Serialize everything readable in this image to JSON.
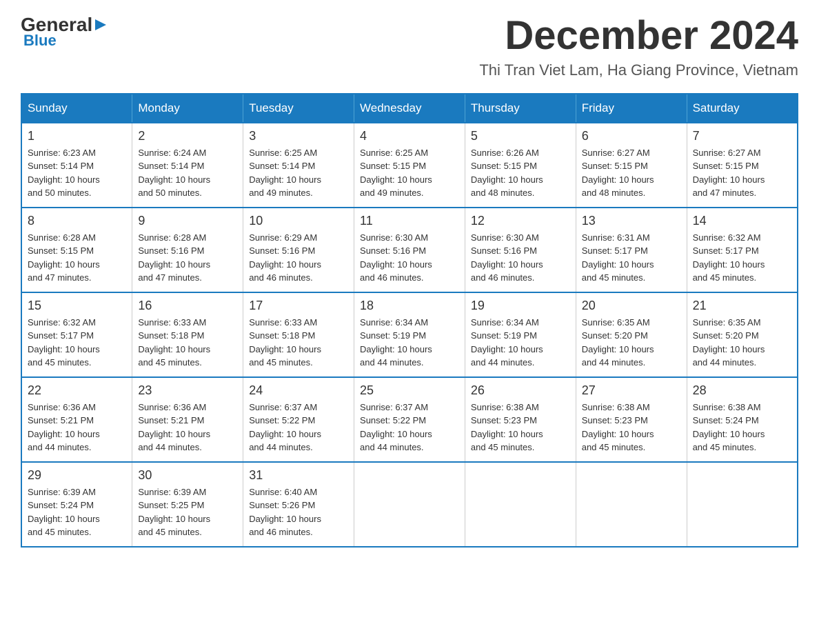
{
  "logo": {
    "general": "General",
    "blue": "Blue",
    "arrow": "▶"
  },
  "title": "December 2024",
  "location": "Thi Tran Viet Lam, Ha Giang Province, Vietnam",
  "days_of_week": [
    "Sunday",
    "Monday",
    "Tuesday",
    "Wednesday",
    "Thursday",
    "Friday",
    "Saturday"
  ],
  "weeks": [
    [
      {
        "num": "1",
        "sunrise": "6:23 AM",
        "sunset": "5:14 PM",
        "daylight": "10 hours and 50 minutes."
      },
      {
        "num": "2",
        "sunrise": "6:24 AM",
        "sunset": "5:14 PM",
        "daylight": "10 hours and 50 minutes."
      },
      {
        "num": "3",
        "sunrise": "6:25 AM",
        "sunset": "5:14 PM",
        "daylight": "10 hours and 49 minutes."
      },
      {
        "num": "4",
        "sunrise": "6:25 AM",
        "sunset": "5:15 PM",
        "daylight": "10 hours and 49 minutes."
      },
      {
        "num": "5",
        "sunrise": "6:26 AM",
        "sunset": "5:15 PM",
        "daylight": "10 hours and 48 minutes."
      },
      {
        "num": "6",
        "sunrise": "6:27 AM",
        "sunset": "5:15 PM",
        "daylight": "10 hours and 48 minutes."
      },
      {
        "num": "7",
        "sunrise": "6:27 AM",
        "sunset": "5:15 PM",
        "daylight": "10 hours and 47 minutes."
      }
    ],
    [
      {
        "num": "8",
        "sunrise": "6:28 AM",
        "sunset": "5:15 PM",
        "daylight": "10 hours and 47 minutes."
      },
      {
        "num": "9",
        "sunrise": "6:28 AM",
        "sunset": "5:16 PM",
        "daylight": "10 hours and 47 minutes."
      },
      {
        "num": "10",
        "sunrise": "6:29 AM",
        "sunset": "5:16 PM",
        "daylight": "10 hours and 46 minutes."
      },
      {
        "num": "11",
        "sunrise": "6:30 AM",
        "sunset": "5:16 PM",
        "daylight": "10 hours and 46 minutes."
      },
      {
        "num": "12",
        "sunrise": "6:30 AM",
        "sunset": "5:16 PM",
        "daylight": "10 hours and 46 minutes."
      },
      {
        "num": "13",
        "sunrise": "6:31 AM",
        "sunset": "5:17 PM",
        "daylight": "10 hours and 45 minutes."
      },
      {
        "num": "14",
        "sunrise": "6:32 AM",
        "sunset": "5:17 PM",
        "daylight": "10 hours and 45 minutes."
      }
    ],
    [
      {
        "num": "15",
        "sunrise": "6:32 AM",
        "sunset": "5:17 PM",
        "daylight": "10 hours and 45 minutes."
      },
      {
        "num": "16",
        "sunrise": "6:33 AM",
        "sunset": "5:18 PM",
        "daylight": "10 hours and 45 minutes."
      },
      {
        "num": "17",
        "sunrise": "6:33 AM",
        "sunset": "5:18 PM",
        "daylight": "10 hours and 45 minutes."
      },
      {
        "num": "18",
        "sunrise": "6:34 AM",
        "sunset": "5:19 PM",
        "daylight": "10 hours and 44 minutes."
      },
      {
        "num": "19",
        "sunrise": "6:34 AM",
        "sunset": "5:19 PM",
        "daylight": "10 hours and 44 minutes."
      },
      {
        "num": "20",
        "sunrise": "6:35 AM",
        "sunset": "5:20 PM",
        "daylight": "10 hours and 44 minutes."
      },
      {
        "num": "21",
        "sunrise": "6:35 AM",
        "sunset": "5:20 PM",
        "daylight": "10 hours and 44 minutes."
      }
    ],
    [
      {
        "num": "22",
        "sunrise": "6:36 AM",
        "sunset": "5:21 PM",
        "daylight": "10 hours and 44 minutes."
      },
      {
        "num": "23",
        "sunrise": "6:36 AM",
        "sunset": "5:21 PM",
        "daylight": "10 hours and 44 minutes."
      },
      {
        "num": "24",
        "sunrise": "6:37 AM",
        "sunset": "5:22 PM",
        "daylight": "10 hours and 44 minutes."
      },
      {
        "num": "25",
        "sunrise": "6:37 AM",
        "sunset": "5:22 PM",
        "daylight": "10 hours and 44 minutes."
      },
      {
        "num": "26",
        "sunrise": "6:38 AM",
        "sunset": "5:23 PM",
        "daylight": "10 hours and 45 minutes."
      },
      {
        "num": "27",
        "sunrise": "6:38 AM",
        "sunset": "5:23 PM",
        "daylight": "10 hours and 45 minutes."
      },
      {
        "num": "28",
        "sunrise": "6:38 AM",
        "sunset": "5:24 PM",
        "daylight": "10 hours and 45 minutes."
      }
    ],
    [
      {
        "num": "29",
        "sunrise": "6:39 AM",
        "sunset": "5:24 PM",
        "daylight": "10 hours and 45 minutes."
      },
      {
        "num": "30",
        "sunrise": "6:39 AM",
        "sunset": "5:25 PM",
        "daylight": "10 hours and 45 minutes."
      },
      {
        "num": "31",
        "sunrise": "6:40 AM",
        "sunset": "5:26 PM",
        "daylight": "10 hours and 46 minutes."
      },
      null,
      null,
      null,
      null
    ]
  ],
  "labels": {
    "sunrise": "Sunrise:",
    "sunset": "Sunset:",
    "daylight": "Daylight:"
  }
}
